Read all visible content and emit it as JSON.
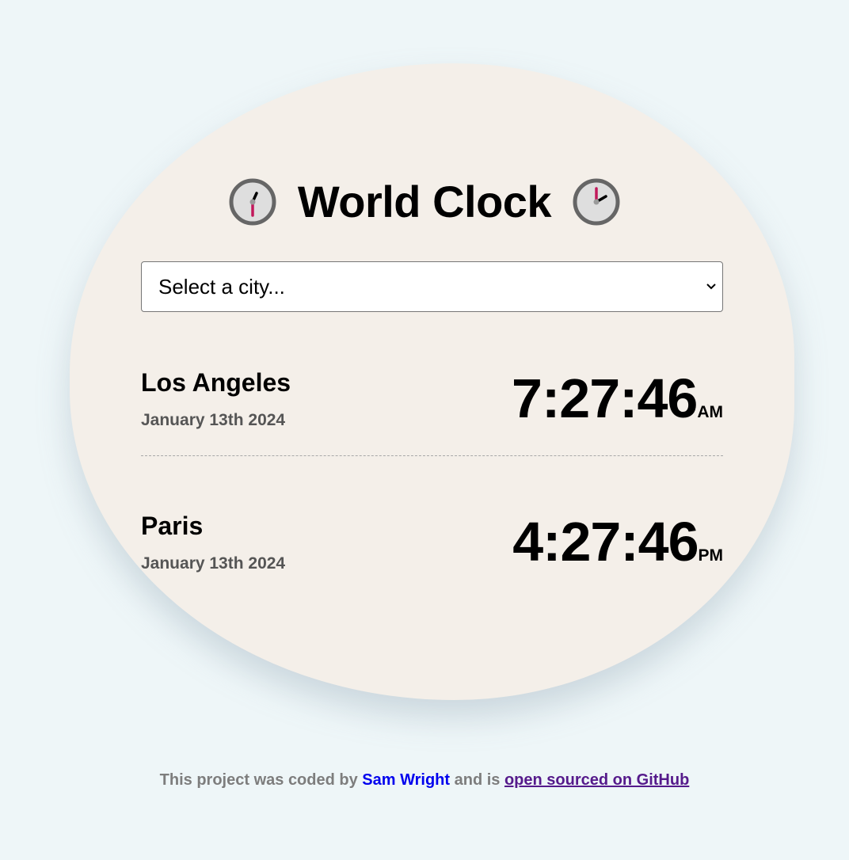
{
  "app": {
    "title": "World Clock"
  },
  "city_select": {
    "selected": "Select a city..."
  },
  "cities": [
    {
      "name": "Los Angeles",
      "date": "January 13th 2024",
      "time": "7:27:46",
      "ampm": "AM"
    },
    {
      "name": "Paris",
      "date": "January 13th 2024",
      "time": "4:27:46",
      "ampm": "PM"
    }
  ],
  "footer": {
    "text_1": "This project was coded by ",
    "author": "Sam Wright",
    "text_2": " and is ",
    "github_link": "open sourced on GitHub"
  },
  "colors": {
    "page_background": "#eef6f8",
    "card_background": "#f4efe9",
    "clock_frame": "#666666",
    "clock_face": "#dedede",
    "clock_minute_hand": "#c2185b",
    "date_text": "#555555",
    "footer_text": "#7d7d7d",
    "link": "#0000ee",
    "visited_link": "#551a8b"
  },
  "icons": {
    "left": "clock-six-thirty-icon",
    "right": "clock-two-icon",
    "select_caret": "chevron-down-icon"
  }
}
